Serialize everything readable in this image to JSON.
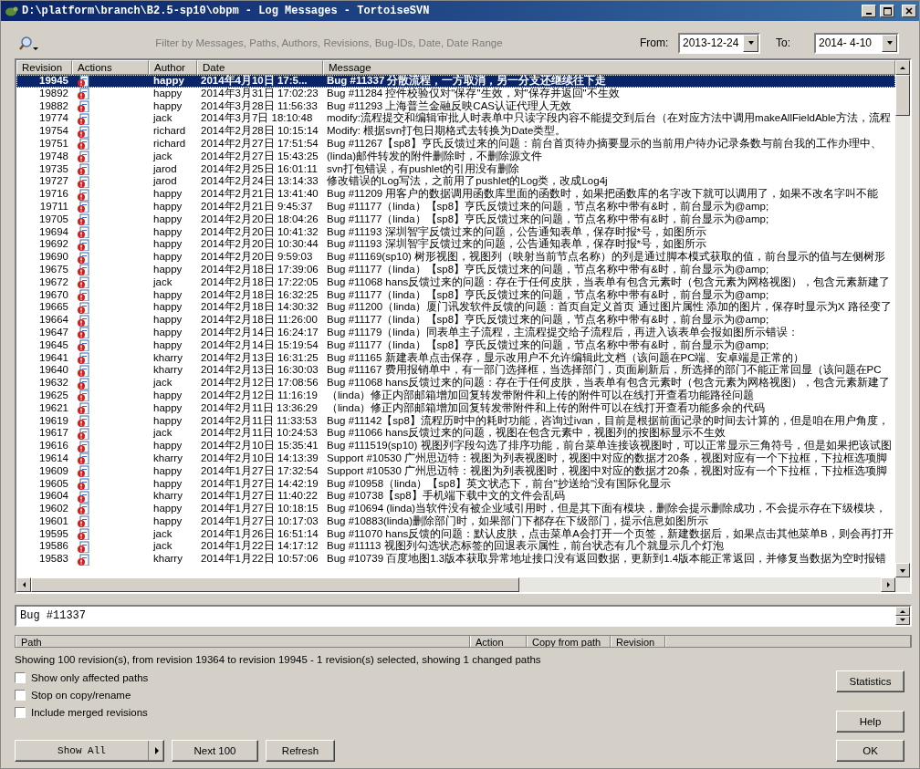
{
  "window": {
    "title": "D:\\platform\\branch\\B2.5-sp10\\obpm - Log Messages - TortoiseSVN"
  },
  "filter": {
    "placeholder": "Filter by Messages, Paths, Authors, Revisions, Bug-IDs, Date, Date Range"
  },
  "from": {
    "label": "From:",
    "value": "2013-12-24"
  },
  "to": {
    "label": "To:",
    "value": "2014- 4-10"
  },
  "log": {
    "columns": [
      "Revision",
      "Actions",
      "Author",
      "Date",
      "Message"
    ],
    "rows": [
      {
        "revision": "19945",
        "author": "happy",
        "date": "2014年4月10日 17:5...",
        "message": "Bug #11337 分散流程，一方取消，另一分支还继续往下走",
        "selected": true
      },
      {
        "revision": "19892",
        "author": "happy",
        "date": "2014年3月31日 17:02:23",
        "message": "Bug #11284 控件校验仅对\"保存\"生效，对\"保存并返回\"不生效",
        "selected": false
      },
      {
        "revision": "19882",
        "author": "happy",
        "date": "2014年3月28日 11:56:33",
        "message": "Bug #11293 上海普兰金融反映CAS认证代理人无效",
        "selected": false
      },
      {
        "revision": "19774",
        "author": "jack",
        "date": "2014年3月7日 18:10:48",
        "message": "modify:流程提交和编辑审批人时表单中只读字段内容不能提交到后台（在对应方法中调用makeAllFieldAble方法，流程",
        "selected": false
      },
      {
        "revision": "19754",
        "author": "richard",
        "date": "2014年2月28日 10:15:14",
        "message": "Modify: 根据svn打包日期格式去转换为Date类型。",
        "selected": false
      },
      {
        "revision": "19751",
        "author": "richard",
        "date": "2014年2月27日 17:51:54",
        "message": "Bug #11267【sp8】亨氏反馈过来的问题：前台首页待办摘要显示的当前用户待办记录条数与前台我的工作办理中、",
        "selected": false
      },
      {
        "revision": "19748",
        "author": "jack",
        "date": "2014年2月27日 15:43:25",
        "message": "(linda)邮件转发的附件删除时，不删除源文件",
        "selected": false
      },
      {
        "revision": "19735",
        "author": "jarod",
        "date": "2014年2月25日 16:01:11",
        "message": "svn打包错误，有pushlet的引用没有删除",
        "selected": false
      },
      {
        "revision": "19727",
        "author": "jarod",
        "date": "2014年2月24日 13:14:33",
        "message": "修改错误的Log写法，之前用了pushlet的Log类，改成Log4j",
        "selected": false
      },
      {
        "revision": "19716",
        "author": "happy",
        "date": "2014年2月21日 13:41:40",
        "message": "Bug #11209 用客户的数据调用函数库里面的函数时，如果把函数库的名字改下就可以调用了，如果不改名字叫不能",
        "selected": false
      },
      {
        "revision": "19711",
        "author": "happy",
        "date": "2014年2月21日 9:45:37",
        "message": "Bug #11177（linda）【sp8】亨氏反馈过来的问题，节点名称中带有&时，前台显示为@amp;",
        "selected": false
      },
      {
        "revision": "19705",
        "author": "happy",
        "date": "2014年2月20日 18:04:26",
        "message": "Bug #11177（linda）【sp8】亨氏反馈过来的问题，节点名称中带有&时，前台显示为@amp;",
        "selected": false
      },
      {
        "revision": "19694",
        "author": "happy",
        "date": "2014年2月20日 10:41:32",
        "message": "Bug #11193 深圳智宇反馈过来的问题，公告通知表单，保存时报*号，如图所示",
        "selected": false
      },
      {
        "revision": "19692",
        "author": "happy",
        "date": "2014年2月20日 10:30:44",
        "message": "Bug #11193 深圳智宇反馈过来的问题，公告通知表单，保存时报*号，如图所示",
        "selected": false
      },
      {
        "revision": "19690",
        "author": "happy",
        "date": "2014年2月20日 9:59:03",
        "message": "Bug #11169(sp10) 树形视图，视图列（映射当前节点名称）的列是通过脚本模式获取的值，前台显示的值与左侧树形",
        "selected": false
      },
      {
        "revision": "19675",
        "author": "happy",
        "date": "2014年2月18日 17:39:06",
        "message": "Bug #11177（linda）【sp8】亨氏反馈过来的问题，节点名称中带有&时，前台显示为@amp;",
        "selected": false
      },
      {
        "revision": "19672",
        "author": "jack",
        "date": "2014年2月18日 17:22:05",
        "message": "Bug #11068 hans反馈过来的问题：存在于任何皮肤，当表单有包含元素时（包含元素为网格视图），包含元素新建了",
        "selected": false
      },
      {
        "revision": "19670",
        "author": "happy",
        "date": "2014年2月18日 16:32:25",
        "message": "Bug #11177（linda）【sp8】亨氏反馈过来的问题，节点名称中带有&时，前台显示为@amp;",
        "selected": false
      },
      {
        "revision": "19665",
        "author": "happy",
        "date": "2014年2月18日 14:30:32",
        "message": "Bug #11200（linda）厦门讯发软件反馈的问题：首页自定义首页 通过图片属性 添加的图片，保存时显示为X 路径变了",
        "selected": false
      },
      {
        "revision": "19664",
        "author": "happy",
        "date": "2014年2月18日 11:26:00",
        "message": "Bug #11177（linda）【sp8】亨氏反馈过来的问题，节点名称中带有&时，前台显示为@amp;",
        "selected": false
      },
      {
        "revision": "19647",
        "author": "happy",
        "date": "2014年2月14日 16:24:17",
        "message": "Bug #11179（linda）同表单主子流程，主流程提交给子流程后，再进入该表单会报如图所示错误：",
        "selected": false
      },
      {
        "revision": "19645",
        "author": "happy",
        "date": "2014年2月14日 15:19:54",
        "message": "Bug #11177（linda）【sp8】亨氏反馈过来的问题，节点名称中带有&时，前台显示为@amp;",
        "selected": false
      },
      {
        "revision": "19641",
        "author": "kharry",
        "date": "2014年2月13日 16:31:25",
        "message": "Bug #11165 新建表单点击保存，显示改用户不允许编辑此文档（该问题在PC端、安卓端是正常的）",
        "selected": false
      },
      {
        "revision": "19640",
        "author": "kharry",
        "date": "2014年2月13日 16:30:03",
        "message": "Bug #11167 费用报销单中，有一部门选择框，当选择部门，页面刷新后，所选择的部门不能正常回显（该问题在PC",
        "selected": false
      },
      {
        "revision": "19632",
        "author": "jack",
        "date": "2014年2月12日 17:08:56",
        "message": "Bug #11068 hans反馈过来的问题：存在于任何皮肤，当表单有包含元素时（包含元素为网格视图），包含元素新建了",
        "selected": false
      },
      {
        "revision": "19625",
        "author": "happy",
        "date": "2014年2月12日 11:16:19",
        "message": "（linda）修正内部邮箱增加回复转发带附件和上传的附件可以在线打开查看功能路径问题",
        "selected": false
      },
      {
        "revision": "19621",
        "author": "happy",
        "date": "2014年2月11日 13:36:29",
        "message": "（linda）修正内部邮箱增加回复转发带附件和上传的附件可以在线打开查看功能多余的代码",
        "selected": false
      },
      {
        "revision": "19619",
        "author": "happy",
        "date": "2014年2月11日 11:33:53",
        "message": "Bug #11142【sp8】流程历时中的耗时功能，咨询过ivan，目前是根据前面记录的时间去计算的，但是咱在用户角度，",
        "selected": false
      },
      {
        "revision": "19617",
        "author": "jack",
        "date": "2014年2月11日 10:24:53",
        "message": "Bug #11066 hans反馈过来的问题，视图在包含元素中，视图列的按图标显示不生效",
        "selected": false
      },
      {
        "revision": "19616",
        "author": "happy",
        "date": "2014年2月10日 15:35:41",
        "message": "Bug #111519(sp10) 视图列字段勾选了排序功能，前台菜单连接该视图时，可以正常显示三角符号，但是如果把该试图",
        "selected": false
      },
      {
        "revision": "19614",
        "author": "kharry",
        "date": "2014年2月10日 14:13:39",
        "message": "Support #10530 广州思迈特：视图为列表视图时，视图中对应的数据才20条，视图对应有一个下拉框，下拉框选项脚",
        "selected": false
      },
      {
        "revision": "19609",
        "author": "happy",
        "date": "2014年1月27日 17:32:54",
        "message": "Support #10530 广州思迈特：视图为列表视图时，视图中对应的数据才20条，视图对应有一个下拉框，下拉框选项脚",
        "selected": false
      },
      {
        "revision": "19605",
        "author": "happy",
        "date": "2014年1月27日 14:42:19",
        "message": "Bug #10958（linda）【sp8】英文状态下，前台\"抄送给\"没有国际化显示",
        "selected": false
      },
      {
        "revision": "19604",
        "author": "kharry",
        "date": "2014年1月27日 11:40:22",
        "message": "Bug #10738【sp8】手机端下载中文的文件会乱码",
        "selected": false
      },
      {
        "revision": "19602",
        "author": "happy",
        "date": "2014年1月27日 10:18:15",
        "message": "Bug #10694 (linda)当软件没有被企业域引用时，但是其下面有模块，删除会提示删除成功，不会提示存在下级模块，",
        "selected": false
      },
      {
        "revision": "19601",
        "author": "happy",
        "date": "2014年1月27日 10:17:03",
        "message": "Bug #10883(linda)删除部门时，如果部门下都存在下级部门，提示信息如图所示",
        "selected": false
      },
      {
        "revision": "19595",
        "author": "jack",
        "date": "2014年1月26日 16:51:14",
        "message": "Bug #11070 hans反馈的问题：默认皮肤，点击菜单A会打开一个页签，新建数据后，如果点击其他菜单B，则会再打开",
        "selected": false
      },
      {
        "revision": "19586",
        "author": "jack",
        "date": "2014年1月22日 14:17:12",
        "message": "Bug #11113 视图列勾选状态标签的回退表示属性，前台状态有几个就显示几个灯泡",
        "selected": false
      },
      {
        "revision": "19583",
        "author": "kharry",
        "date": "2014年1月22日 10:57:06",
        "message": "Bug #10739 百度地图1.3版本获取异常地址接口没有返回数据，更新到1.4版本能正常返回，并修复当数据为空时报错",
        "selected": false
      }
    ]
  },
  "message": {
    "value": "Bug #11337"
  },
  "paths": {
    "columns": [
      "Path",
      "Action",
      "Copy from path",
      "Revision"
    ]
  },
  "status": "Showing 100 revision(s), from revision 19364 to revision 19945 - 1 revision(s) selected, showing 1 changed paths",
  "options": [
    {
      "label": "Show only affected paths",
      "checked": false
    },
    {
      "label": "Stop on copy/rename",
      "checked": false
    },
    {
      "label": "Include merged revisions",
      "checked": false
    }
  ],
  "buttons": {
    "show_all": "Show All",
    "next": "Next 100",
    "refresh": "Refresh",
    "statistics": "Statistics",
    "help": "Help",
    "ok": "OK"
  }
}
